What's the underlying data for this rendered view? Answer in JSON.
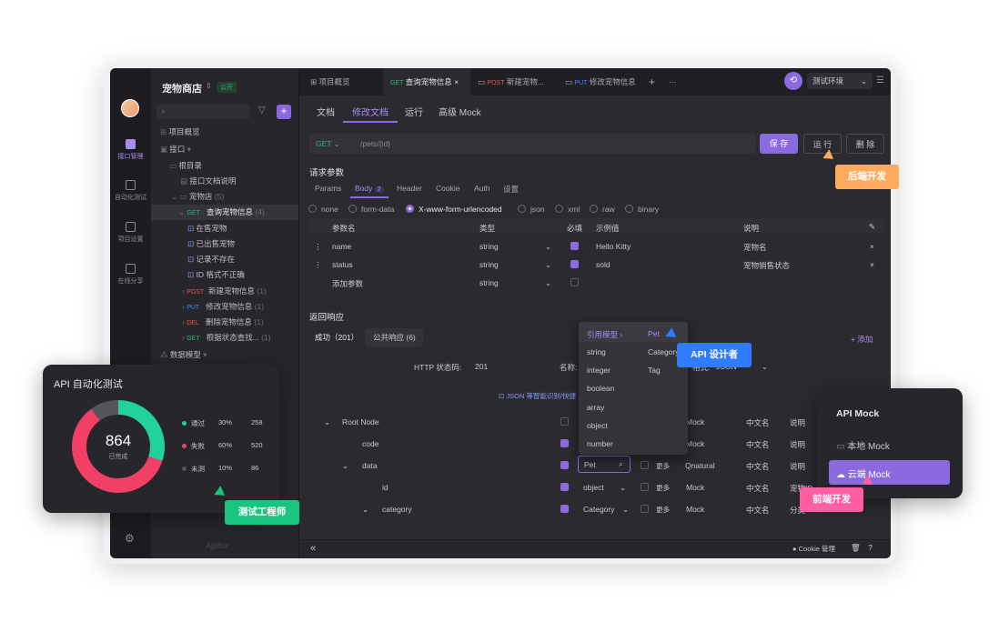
{
  "app": {
    "project_name": "宠物商店",
    "public_badge": "公开"
  },
  "rail": {
    "items": [
      "接口管理",
      "自动化测试",
      "项目设置",
      "在线分享"
    ]
  },
  "tree": {
    "search_placeholder": "",
    "items": {
      "overview": "项目概览",
      "api": "接口",
      "root": "根目录",
      "api_doc": "接口文档说明",
      "pet_store": "宠物店",
      "pet_store_count": "(5)",
      "get_pet": "查询宠物信息",
      "get_pet_count": "(4)",
      "case1": "在售宠物",
      "case2": "已出售宠物",
      "case3": "记录不存在",
      "case4": "ID 格式不正确",
      "post_pet": "新建宠物信息",
      "put_pet": "修改宠物信息",
      "del_pet": "删除宠物信息",
      "get_status": "根据状态查找...",
      "count1": "(1)",
      "models": "数据模型"
    },
    "methods": {
      "get": "GET",
      "post": "POST",
      "put": "PUT",
      "del": "DEL"
    }
  },
  "tabs": {
    "overview": "项目概览",
    "get_method": "GET",
    "get_label": "查询宠物信息",
    "post_method": "POST",
    "post_label": "新建宠物...",
    "put_method": "PUT",
    "put_label": "修改宠物信息",
    "plus": "+",
    "more": "···",
    "env": "测试环境"
  },
  "subtabs": [
    "文档",
    "修改文档",
    "运行",
    "高级 Mock"
  ],
  "request": {
    "method": "GET",
    "url": "/pets/{id}",
    "save": "保 存",
    "run": "运 行",
    "delete": "删 除",
    "section_title": "请求参数",
    "param_tabs": [
      "Params",
      "Body",
      "Header",
      "Cookie",
      "Auth",
      "设置"
    ],
    "body_count": "2",
    "body_types": [
      "none",
      "form-data",
      "X-www-form-urlencoded",
      "json",
      "xml",
      "raw",
      "binary"
    ],
    "columns": [
      "参数名",
      "类型",
      "必填",
      "示例值",
      "说明"
    ],
    "rows": [
      {
        "name": "name",
        "type": "string",
        "example": "Hello Kitty",
        "desc": "宠物名"
      },
      {
        "name": "status",
        "type": "string",
        "example": "sold",
        "desc": "宠物销售状态"
      }
    ],
    "add_param": "添加参数",
    "add_type": "string"
  },
  "response": {
    "section_title": "返回响应",
    "tab_success": "成功（201）",
    "tab_public": "公共响应 (6)",
    "add": "+ 添加",
    "status_label": "HTTP 状态码:",
    "status_value": "201",
    "name_label": "名称:",
    "format_label": "格式:",
    "format_value": "JSON",
    "smart_hint": "JSON 等智能识别/快捷",
    "tree_rows": {
      "root": "Root Node",
      "code": "code",
      "data": "data",
      "id": "id",
      "category": "category",
      "pet_value": "Pet",
      "object": "object",
      "category_type": "Category",
      "more": "更多",
      "qnatural": "Qnatural",
      "mock": "Mock",
      "cn_name": "中文名",
      "desc": "说明",
      "pet_id": "宠物ID",
      "cat_short": "分类"
    }
  },
  "dropdown": {
    "header_ref": "引用模型",
    "header_pet": "Pet",
    "types": [
      "string",
      "integer",
      "boolean",
      "array",
      "object",
      "number"
    ],
    "models": [
      "Category",
      "Tag"
    ]
  },
  "autotest": {
    "title": "API 自动化测试",
    "total": "864",
    "total_label": "已完成",
    "legend": [
      {
        "label": "通过",
        "pct": "30%",
        "count": "258",
        "color": "#21d39b",
        "value": 30
      },
      {
        "label": "失败",
        "pct": "60%",
        "count": "520",
        "color": "#f23f66",
        "value": 60
      },
      {
        "label": "未测",
        "pct": "10%",
        "count": "86",
        "color": "#55555b",
        "value": 10
      }
    ]
  },
  "mockcard": {
    "title": "API Mock",
    "local": "本地 Mock",
    "cloud": "云端 Mock"
  },
  "roles": {
    "backend": "后端开发",
    "designer": "API 设计者",
    "tester": "测试工程师",
    "frontend": "前端开发"
  },
  "footer": {
    "cookie": "Cookie 管理",
    "collapse": "«",
    "brand": "Apifox"
  },
  "colors": {
    "accent": "#8b6ae0",
    "backend": "#ffab5e",
    "designer": "#2f7cff",
    "tester": "#19c47f",
    "frontend": "#ff5fa2"
  }
}
